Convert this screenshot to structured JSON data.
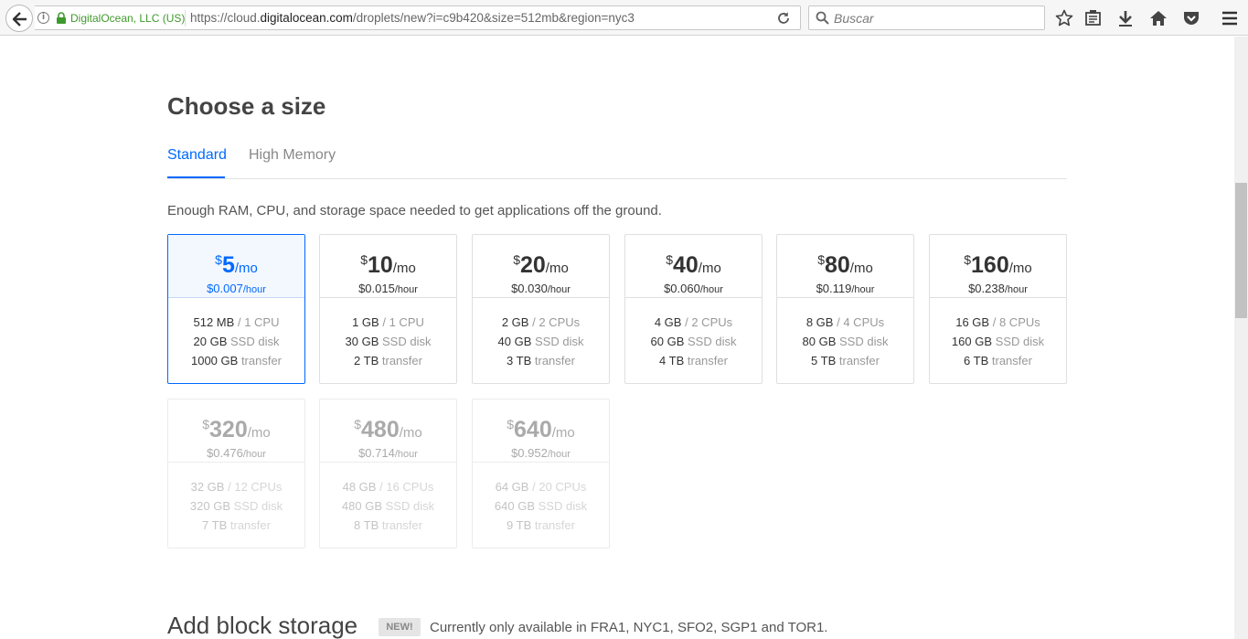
{
  "browser": {
    "site_identity": "DigitalOcean, LLC (US)",
    "url_prefix": "https://cloud.",
    "url_domain": "digitalocean.com",
    "url_suffix": "/droplets/new?i=c9b420&size=512mb&region=nyc3",
    "search_placeholder": "Buscar",
    "toolbar_icons": [
      "star-icon",
      "reading-list-icon",
      "download-icon",
      "home-icon",
      "pocket-icon",
      "menu-icon"
    ]
  },
  "page": {
    "title": "Choose a size",
    "tabs": [
      {
        "label": "Standard",
        "active": true
      },
      {
        "label": "High Memory",
        "active": false
      }
    ],
    "description": "Enough RAM, CPU, and storage space needed to get applications off the ground.",
    "currency": "$",
    "per_month": "/mo",
    "per_hour": "/hour",
    "spec_labels": {
      "cpu_sep": "/",
      "disk": "SSD disk",
      "transfer": "transfer"
    },
    "sizes": [
      {
        "monthly": "5",
        "hourly": "$0.007",
        "ram": "512 MB",
        "cpu": "1 CPU",
        "disk": "20 GB",
        "transfer": "1000 GB",
        "state": "selected"
      },
      {
        "monthly": "10",
        "hourly": "$0.015",
        "ram": "1 GB",
        "cpu": "1 CPU",
        "disk": "30 GB",
        "transfer": "2 TB",
        "state": "normal"
      },
      {
        "monthly": "20",
        "hourly": "$0.030",
        "ram": "2 GB",
        "cpu": "2 CPUs",
        "disk": "40 GB",
        "transfer": "3 TB",
        "state": "normal"
      },
      {
        "monthly": "40",
        "hourly": "$0.060",
        "ram": "4 GB",
        "cpu": "2 CPUs",
        "disk": "60 GB",
        "transfer": "4 TB",
        "state": "normal"
      },
      {
        "monthly": "80",
        "hourly": "$0.119",
        "ram": "8 GB",
        "cpu": "4 CPUs",
        "disk": "80 GB",
        "transfer": "5 TB",
        "state": "normal"
      },
      {
        "monthly": "160",
        "hourly": "$0.238",
        "ram": "16 GB",
        "cpu": "8 CPUs",
        "disk": "160 GB",
        "transfer": "6 TB",
        "state": "normal"
      },
      {
        "monthly": "320",
        "hourly": "$0.476",
        "ram": "32 GB",
        "cpu": "12 CPUs",
        "disk": "320 GB",
        "transfer": "7 TB",
        "state": "disabled"
      },
      {
        "monthly": "480",
        "hourly": "$0.714",
        "ram": "48 GB",
        "cpu": "16 CPUs",
        "disk": "480 GB",
        "transfer": "8 TB",
        "state": "disabled"
      },
      {
        "monthly": "640",
        "hourly": "$0.952",
        "ram": "64 GB",
        "cpu": "20 CPUs",
        "disk": "640 GB",
        "transfer": "9 TB",
        "state": "disabled"
      }
    ],
    "block_storage": {
      "title": "Add block storage",
      "badge": "NEW!",
      "note": "Currently only available in FRA1, NYC1, SFO2, SGP1 and TOR1."
    }
  },
  "colors": {
    "accent": "#0069ff",
    "secure": "#3f9a2c"
  }
}
